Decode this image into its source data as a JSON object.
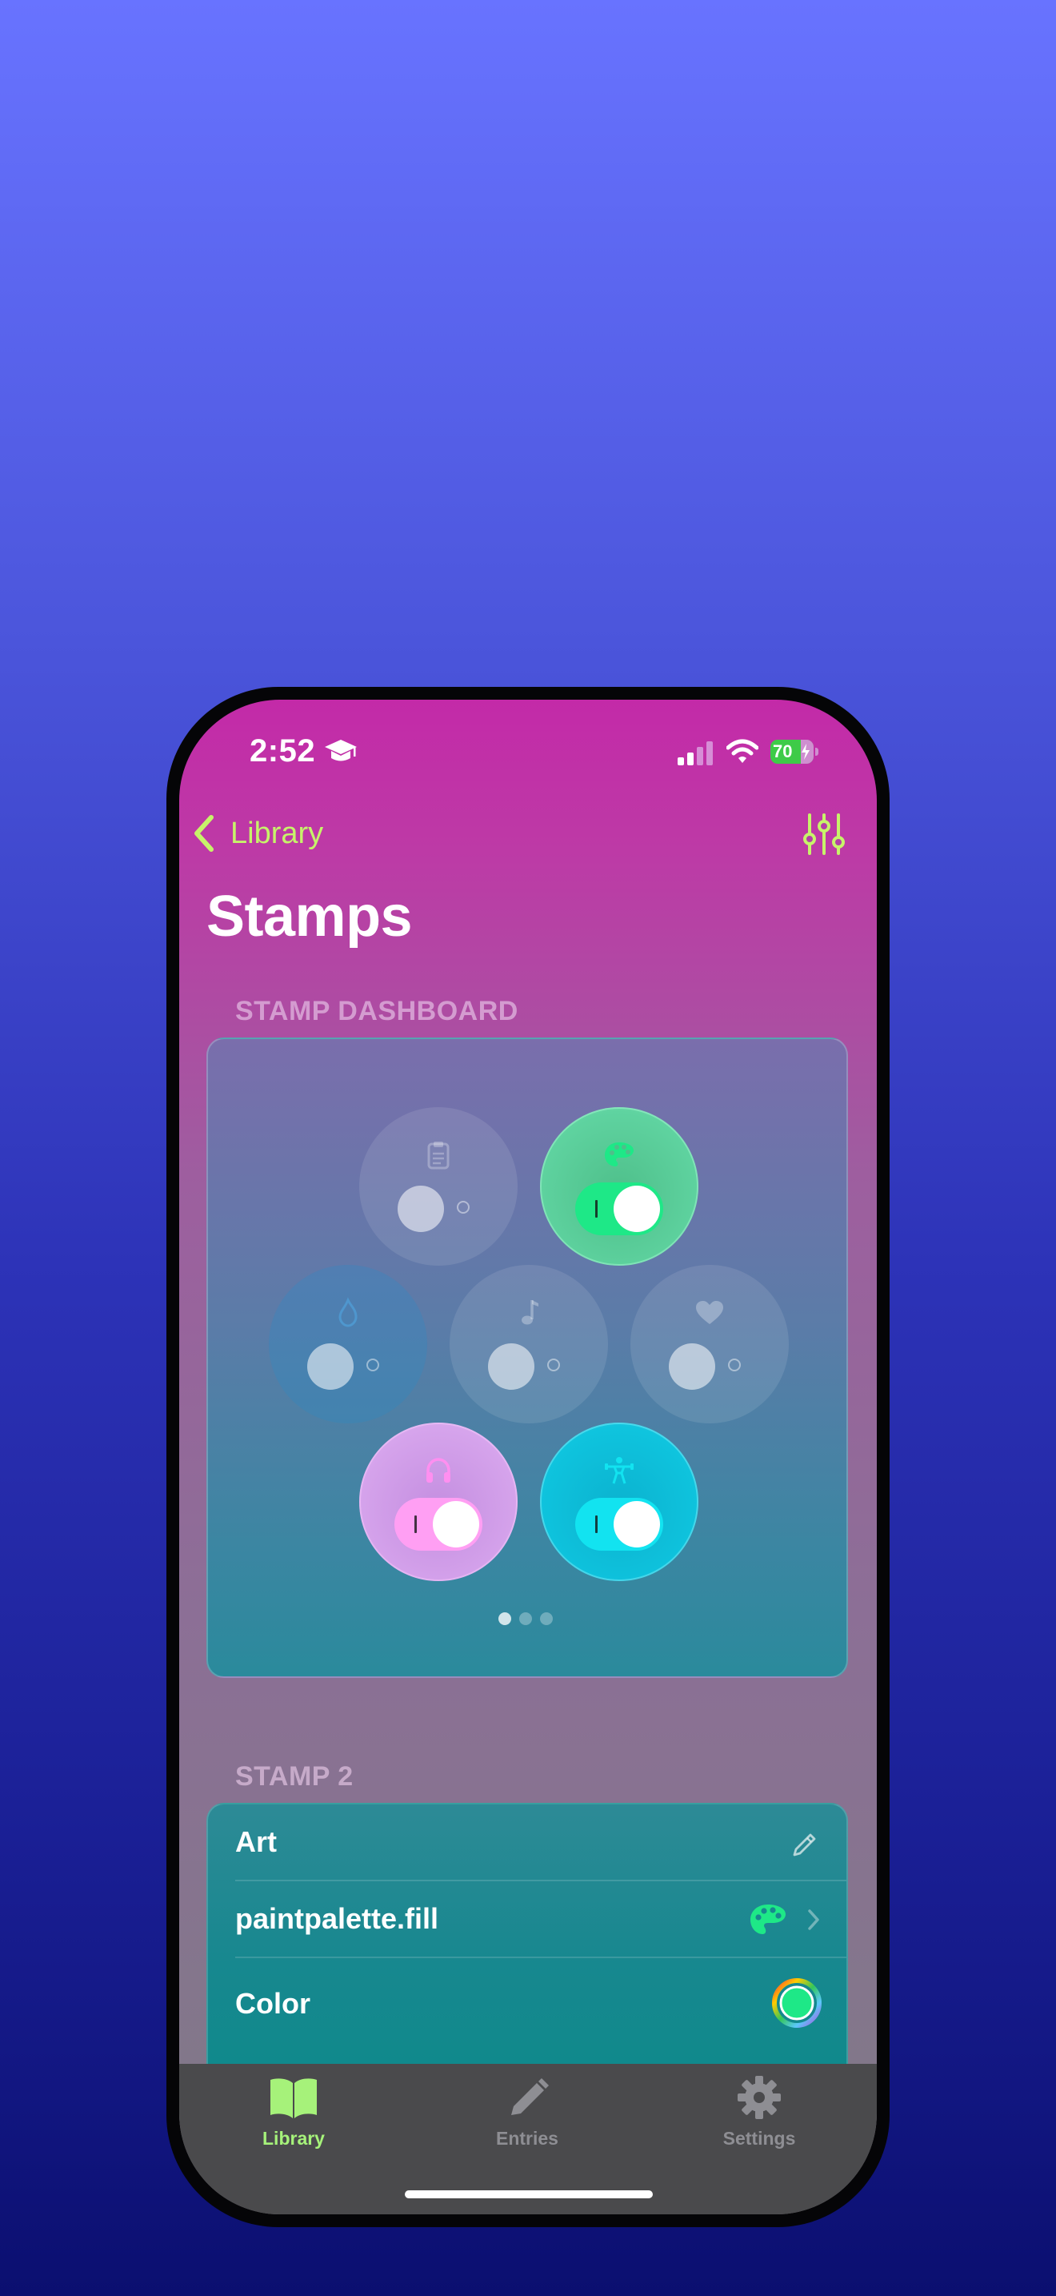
{
  "status_bar": {
    "time": "2:52",
    "battery_level": "70"
  },
  "nav": {
    "back_label": "Library",
    "title": "Stamps"
  },
  "dashboard": {
    "header": "STAMP DASHBOARD",
    "stamps": [
      {
        "icon": "clipboard-icon",
        "on": false,
        "color": "#ffffff"
      },
      {
        "icon": "paintpalette-icon",
        "on": true,
        "color": "#1ee887"
      },
      {
        "icon": "flame-icon",
        "on": false,
        "color": "#2aa8d8"
      },
      {
        "icon": "music-note-icon",
        "on": false,
        "color": "#ffffff"
      },
      {
        "icon": "heart-icon",
        "on": false,
        "color": "#ffffff"
      },
      {
        "icon": "headphones-icon",
        "on": true,
        "color": "#ff9ff3"
      },
      {
        "icon": "figure-strengthtraining-icon",
        "on": true,
        "color": "#12e3f0"
      }
    ],
    "pages": 3,
    "current_page": 1
  },
  "stamp2": {
    "header": "STAMP 2",
    "name": "Art",
    "symbol": "paintpalette.fill",
    "color_label": "Color",
    "color_value": "#1ee887"
  },
  "tabs": [
    {
      "label": "Library",
      "icon": "book-icon",
      "active": true
    },
    {
      "label": "Entries",
      "icon": "pencil-icon",
      "active": false
    },
    {
      "label": "Settings",
      "icon": "gear-icon",
      "active": false
    }
  ],
  "colors": {
    "accent": "#c7f36a",
    "tab_inactive": "#8e8e93"
  }
}
